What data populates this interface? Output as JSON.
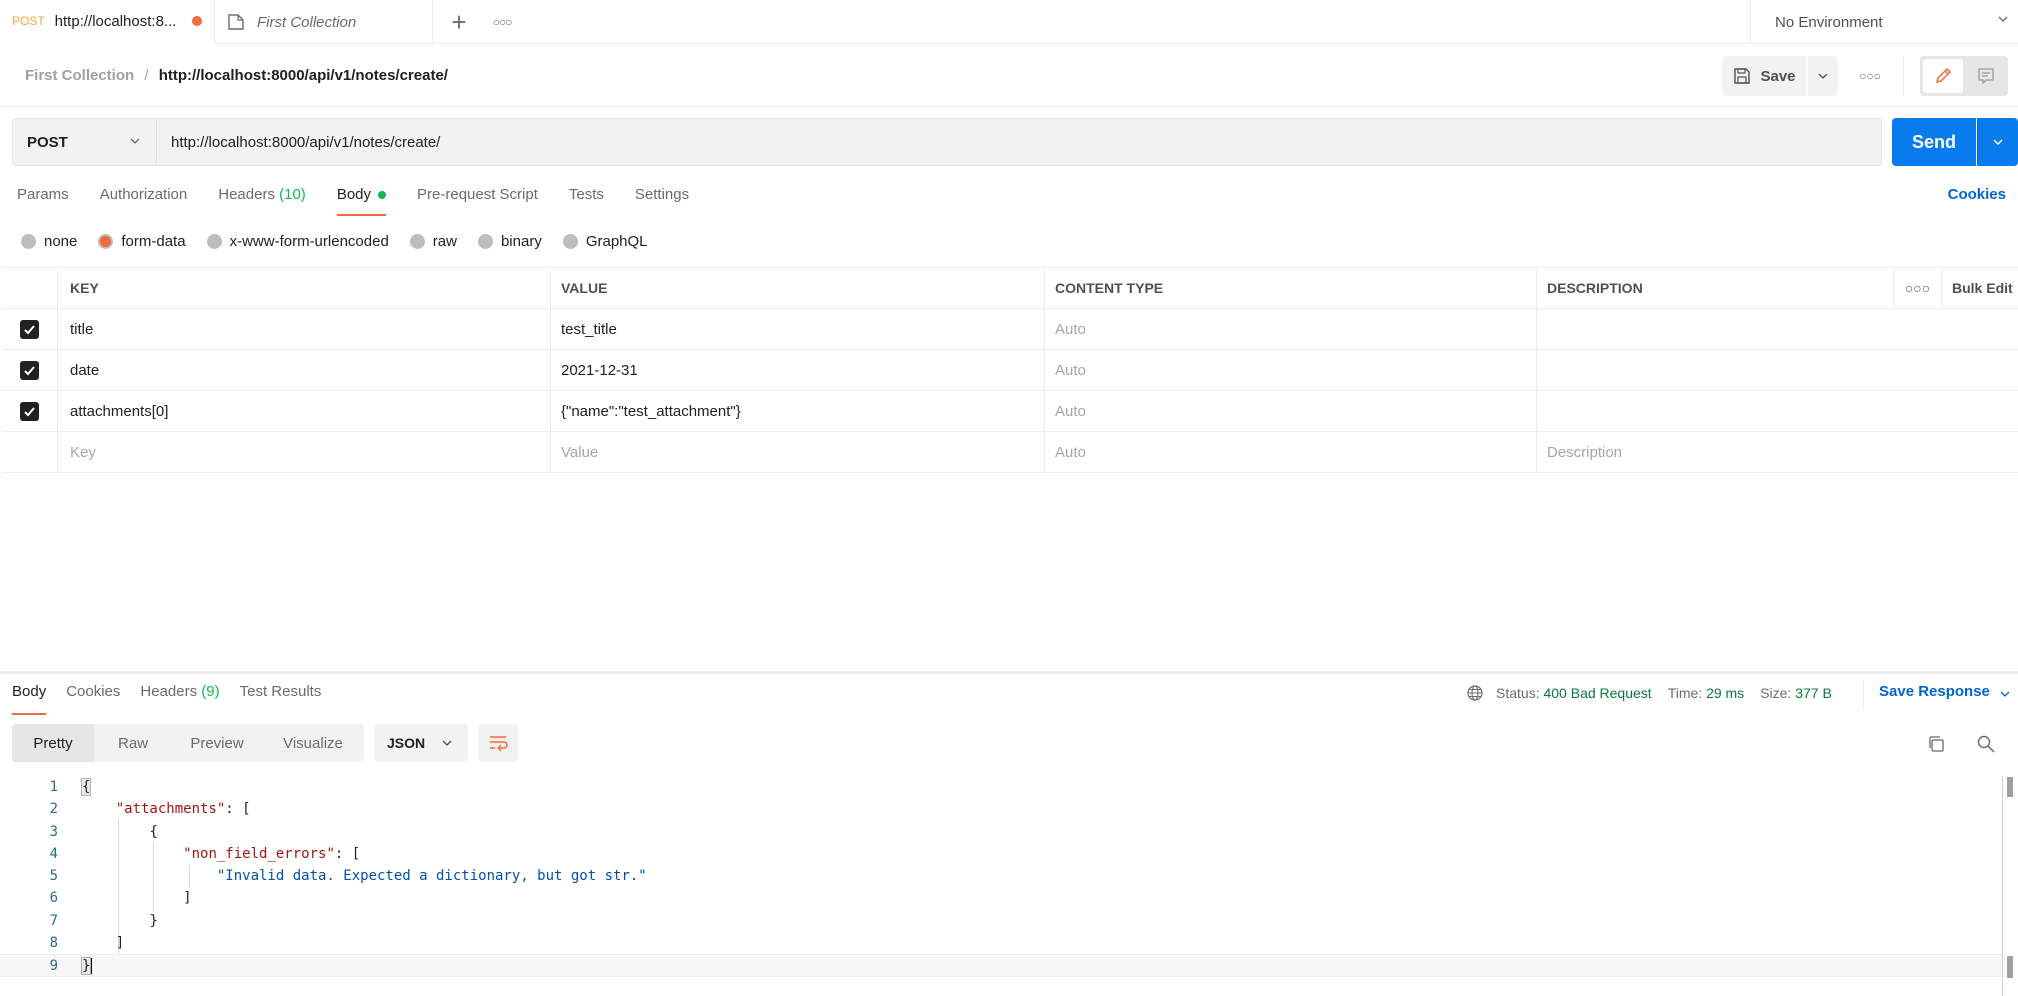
{
  "tabs": {
    "active": {
      "method": "POST",
      "title": "http://localhost:8...",
      "unsaved": true
    },
    "second": {
      "title": "First Collection"
    },
    "new_tab_icon": "plus-icon",
    "more_icon": "more-horizontal-icon"
  },
  "environment": {
    "selected": "No Environment"
  },
  "breadcrumb": {
    "collection": "First Collection",
    "separator": "/",
    "request": "http://localhost:8000/api/v1/notes/create/"
  },
  "header_actions": {
    "save_label": "Save"
  },
  "request": {
    "method": "POST",
    "url": "http://localhost:8000/api/v1/notes/create/",
    "send_label": "Send"
  },
  "request_tabs": [
    {
      "label": "Params"
    },
    {
      "label": "Authorization"
    },
    {
      "label": "Headers",
      "count": "(10)"
    },
    {
      "label": "Body",
      "active": true
    },
    {
      "label": "Pre-request Script"
    },
    {
      "label": "Tests"
    },
    {
      "label": "Settings"
    }
  ],
  "cookies_label": "Cookies",
  "body_types": [
    {
      "label": "none"
    },
    {
      "label": "form-data",
      "selected": true
    },
    {
      "label": "x-www-form-urlencoded"
    },
    {
      "label": "raw"
    },
    {
      "label": "binary"
    },
    {
      "label": "GraphQL"
    }
  ],
  "params_table": {
    "columns": [
      "KEY",
      "VALUE",
      "CONTENT TYPE",
      "DESCRIPTION"
    ],
    "bulk_edit": "Bulk Edit",
    "rows": [
      {
        "checked": true,
        "key": "title",
        "value": "test_title",
        "content_type": "Auto",
        "description": ""
      },
      {
        "checked": true,
        "key": "date",
        "value": "2021-12-31",
        "content_type": "Auto",
        "description": ""
      },
      {
        "checked": true,
        "key": "attachments[0]",
        "value": "{\"name\":\"test_attachment\"}",
        "content_type": "Auto",
        "description": ""
      }
    ],
    "placeholder_row": {
      "key": "Key",
      "value": "Value",
      "content_type": "Auto",
      "description": "Description"
    }
  },
  "response": {
    "tabs": [
      {
        "label": "Body",
        "active": true
      },
      {
        "label": "Cookies"
      },
      {
        "label": "Headers",
        "count": "(9)"
      },
      {
        "label": "Test Results"
      }
    ],
    "status_label": "Status:",
    "status_value": "400 Bad Request",
    "time_label": "Time:",
    "time_value": "29 ms",
    "size_label": "Size:",
    "size_value": "377 B",
    "save_response": "Save Response",
    "views": [
      "Pretty",
      "Raw",
      "Preview",
      "Visualize"
    ],
    "active_view": "Pretty",
    "format": "JSON",
    "code_lines": [
      {
        "n": "1",
        "text": "{"
      },
      {
        "n": "2",
        "key": "\"attachments\"",
        "rest": ": ["
      },
      {
        "n": "3",
        "text": "{"
      },
      {
        "n": "4",
        "key": "\"non_field_errors\"",
        "rest": ": ["
      },
      {
        "n": "5",
        "str": "\"Invalid data. Expected a dictionary, but got str.\""
      },
      {
        "n": "6",
        "text": "]"
      },
      {
        "n": "7",
        "text": "}"
      },
      {
        "n": "8",
        "text": "]"
      },
      {
        "n": "9",
        "text": "}"
      }
    ]
  },
  "colors": {
    "accent_orange": "#f26b3a",
    "send_blue": "#097bed",
    "link_blue": "#0265d2",
    "success_green": "#0cbb52",
    "status_green": "#0a7a3e",
    "method_orange": "#f2a93b"
  }
}
